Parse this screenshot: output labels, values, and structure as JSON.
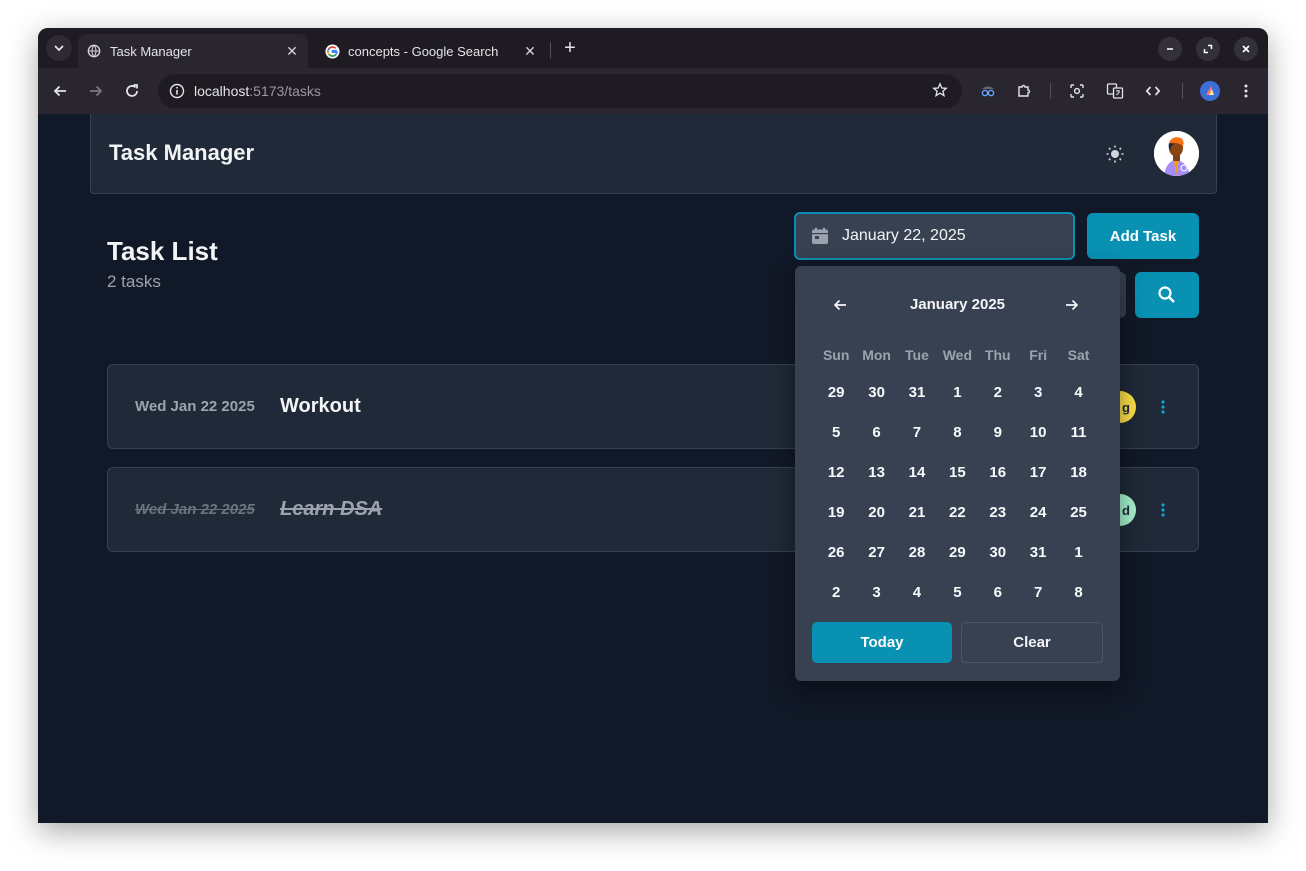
{
  "browser": {
    "tabs": [
      {
        "title": "Task Manager",
        "active": true
      },
      {
        "title": "concepts - Google Search",
        "active": false
      }
    ],
    "url_host": "localhost",
    "url_path": ":5173/tasks"
  },
  "app": {
    "title": "Task Manager"
  },
  "list": {
    "title": "Task List",
    "count": "2 tasks"
  },
  "controls": {
    "date_value": "January 22, 2025",
    "add_task_label": "Add Task"
  },
  "tasks": [
    {
      "date": "Wed Jan 22 2025",
      "name": "Workout",
      "status_text": "g",
      "status_color": "#fde047",
      "completed": false
    },
    {
      "date": "Wed Jan 22 2025",
      "name": "Learn DSA",
      "status_text": "d",
      "status_color": "#a7f3d0",
      "completed": true
    }
  ],
  "calendar": {
    "month_label": "January 2025",
    "weekdays": [
      "Sun",
      "Mon",
      "Tue",
      "Wed",
      "Thu",
      "Fri",
      "Sat"
    ],
    "weeks": [
      [
        "29",
        "30",
        "31",
        "1",
        "2",
        "3",
        "4"
      ],
      [
        "5",
        "6",
        "7",
        "8",
        "9",
        "10",
        "11"
      ],
      [
        "12",
        "13",
        "14",
        "15",
        "16",
        "17",
        "18"
      ],
      [
        "19",
        "20",
        "21",
        "22",
        "23",
        "24",
        "25"
      ],
      [
        "26",
        "27",
        "28",
        "29",
        "30",
        "31",
        "1"
      ],
      [
        "2",
        "3",
        "4",
        "5",
        "6",
        "7",
        "8"
      ]
    ],
    "today_label": "Today",
    "clear_label": "Clear"
  },
  "colors": {
    "accent": "#0891b2",
    "page_bg": "#111827",
    "card_bg": "#1f2937"
  }
}
